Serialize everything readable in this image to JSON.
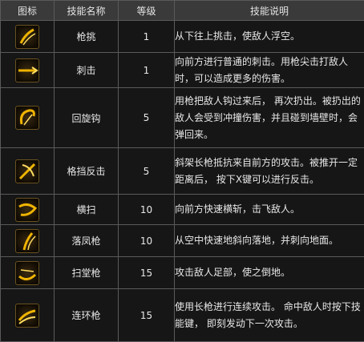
{
  "header": {
    "icon": "图标",
    "name": "技能名称",
    "level": "等级",
    "desc": "技能说明"
  },
  "colors": {
    "header_bg": "#3a3a3a",
    "cell_bg": "#161616",
    "border": "#5a5a5a",
    "icon_gold": "#f0b400"
  },
  "skills": [
    {
      "icon": "spear-thrust-icon",
      "name": "枪挑",
      "level": "1",
      "desc": "从下往上挑击，使敌人浮空。"
    },
    {
      "icon": "stab-icon",
      "name": "刺击",
      "level": "1",
      "desc": "向前方进行普通的刺击。用枪尖击打敌人时，可以造成更多的伤害。"
    },
    {
      "icon": "return-hook-icon",
      "name": "回旋钩",
      "level": "5",
      "desc": "用枪把敌人钩过来后， 再次扔出。被扔出的敌人会受到冲撞伤害，并且碰到墙壁时，会弹回来。"
    },
    {
      "icon": "parry-counter-icon",
      "name": "格挡反击",
      "level": "5",
      "desc": "斜架长枪抵抗来自前方的攻击。被推开一定距离后， 按下X键可以进行反击。"
    },
    {
      "icon": "sweep-icon",
      "name": "横扫",
      "level": "10",
      "desc": "向前方快速横斩，击飞敌人。"
    },
    {
      "icon": "falling-spear-icon",
      "name": "落凤枪",
      "level": "10",
      "desc": "从空中快速地斜向落地，并刺向地面。"
    },
    {
      "icon": "ground-sweep-icon",
      "name": "扫堂枪",
      "level": "15",
      "desc": "攻击敌人足部，使之倒地。"
    },
    {
      "icon": "chain-spear-icon",
      "name": "连环枪",
      "level": "15",
      "desc": "使用长枪进行连续攻击。 命中敌人时按下技能键， 即刻发动下一次攻击。"
    }
  ]
}
